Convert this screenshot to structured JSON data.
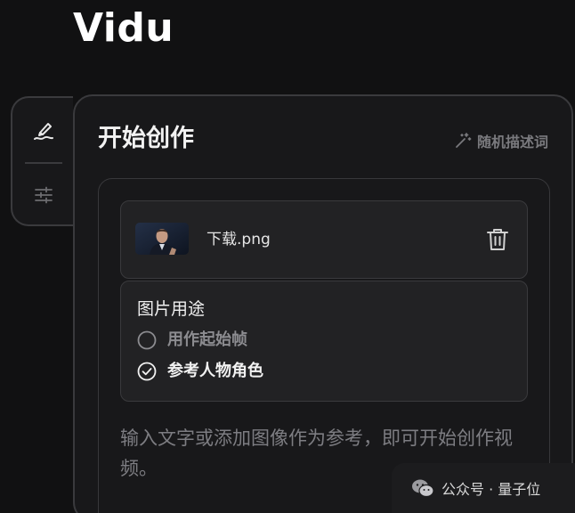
{
  "app": {
    "logo": "Vidu"
  },
  "side_tabs": {
    "items": [
      {
        "icon": "brush-icon",
        "active": true
      },
      {
        "icon": "sliders-icon",
        "active": false
      }
    ]
  },
  "panel": {
    "title": "开始创作",
    "random_prompt_label": "随机描述词",
    "random_prompt_icon": "magic-wand-icon"
  },
  "upload": {
    "file_name": "下载.png",
    "delete_icon": "trash-icon"
  },
  "image_usage": {
    "title": "图片用途",
    "options": [
      {
        "label": "用作起始帧",
        "selected": false
      },
      {
        "label": "参考人物角色",
        "selected": true
      }
    ]
  },
  "prompt": {
    "placeholder": "输入文字或添加图像作为参考，即可开始创作视频。"
  },
  "watermark": {
    "text": "公众号 · 量子位"
  },
  "colors": {
    "background": "#111112",
    "panel": "#18181a",
    "card": "#222224",
    "border": "#3a3a3d",
    "muted_text": "#7d7d82"
  }
}
